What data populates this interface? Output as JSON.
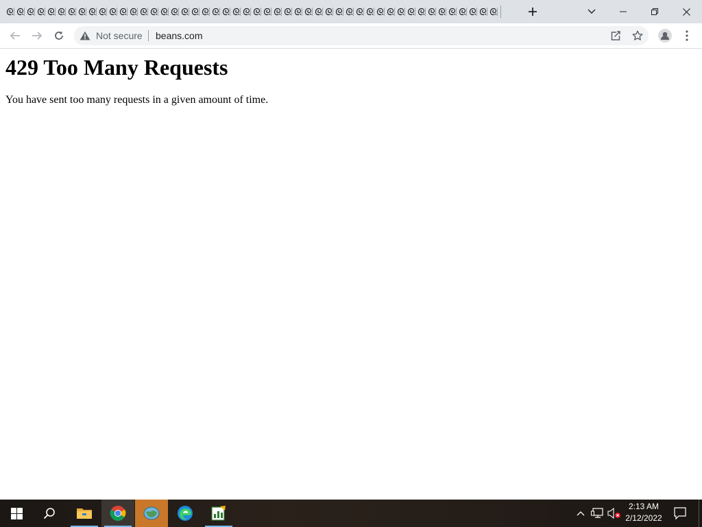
{
  "browser": {
    "tab_count": 48,
    "tab_favicon": "flea-favicon-icon",
    "address": {
      "security_label": "Not secure",
      "url": "beans.com"
    }
  },
  "page": {
    "heading": "429 Too Many Requests",
    "message": "You have sent too many requests in a given amount of time."
  },
  "taskbar": {
    "apps": [
      "file-explorer",
      "google-chrome",
      "map-app",
      "microsoft-edge",
      "chart-app"
    ],
    "active_app": "map-app",
    "clock": {
      "time": "2:13 AM",
      "date": "2/12/2022"
    }
  },
  "colors": {
    "tabstrip": "#dee1e6",
    "omnibox": "#f1f3f4",
    "active_task": "#c9782a",
    "running_indicator": "#76b9ed"
  }
}
